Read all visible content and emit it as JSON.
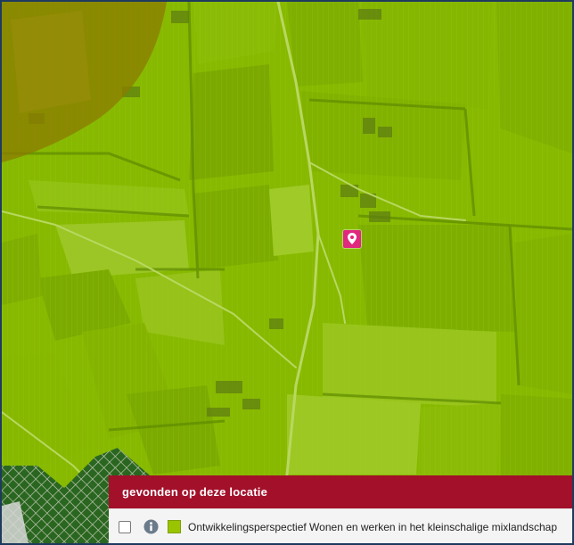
{
  "map": {
    "overlay_color": "#8fbf00",
    "brown_zone_color": "#8a7c00",
    "hatched_zone_color": "#1c5a20",
    "marker_color": "#e0287e",
    "marker_icon": "map-pin-icon"
  },
  "results": {
    "header": "gevonden op deze locatie",
    "items": [
      {
        "checked": false,
        "info_icon": "info-icon",
        "swatch_color": "#9ac400",
        "label": "Ontwikkelingsperspectief Wonen en werken in het kleinschalige mixlandschap"
      }
    ]
  }
}
